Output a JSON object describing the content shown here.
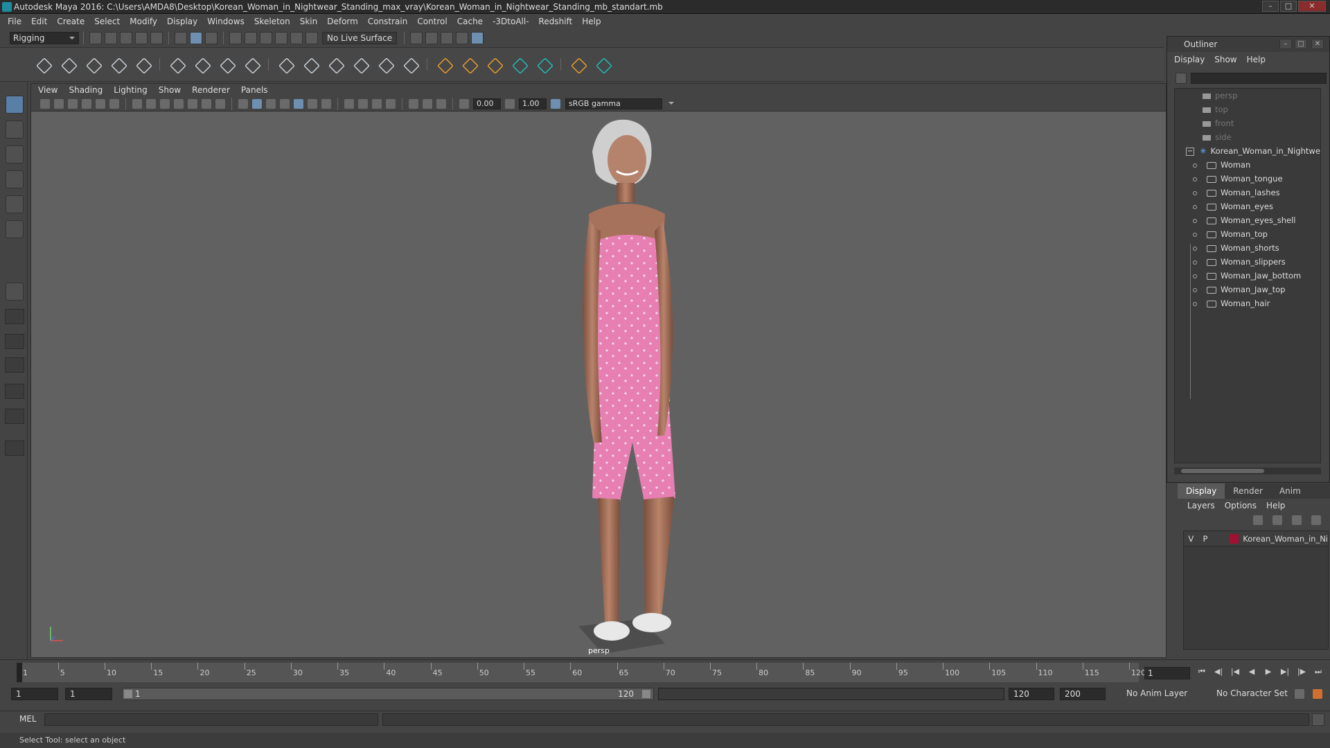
{
  "title_bar": {
    "title": "Autodesk Maya 2016: C:\\Users\\AMDA8\\Desktop\\Korean_Woman_in_Nightwear_Standing_max_vray\\Korean_Woman_in_Nightwear_Standing_mb_standart.mb"
  },
  "menubar": {
    "items": [
      "File",
      "Edit",
      "Create",
      "Select",
      "Modify",
      "Display",
      "Windows",
      "Skeleton",
      "Skin",
      "Deform",
      "Constrain",
      "Control",
      "Cache",
      "-3DtoAll-",
      "Redshift",
      "Help"
    ]
  },
  "status_line": {
    "mode": "Rigging",
    "live_surface": "No Live Surface"
  },
  "viewport": {
    "menu": [
      "View",
      "Shading",
      "Lighting",
      "Show",
      "Renderer",
      "Panels"
    ],
    "exposure": "0.00",
    "gamma": "1.00",
    "color_space": "sRGB gamma",
    "camera_label": "persp"
  },
  "outliner": {
    "title": "Outliner",
    "menu": [
      "Display",
      "Show",
      "Help"
    ],
    "items": [
      {
        "label": "persp",
        "kind": "camera",
        "dim": true
      },
      {
        "label": "top",
        "kind": "camera",
        "dim": true
      },
      {
        "label": "front",
        "kind": "camera",
        "dim": true
      },
      {
        "label": "side",
        "kind": "camera",
        "dim": true
      },
      {
        "label": "Korean_Woman_in_Nightwe",
        "kind": "group",
        "dim": false
      },
      {
        "label": "Woman",
        "kind": "mesh",
        "dim": false
      },
      {
        "label": "Woman_tongue",
        "kind": "mesh",
        "dim": false
      },
      {
        "label": "Woman_lashes",
        "kind": "mesh",
        "dim": false
      },
      {
        "label": "Woman_eyes",
        "kind": "mesh",
        "dim": false
      },
      {
        "label": "Woman_eyes_shell",
        "kind": "mesh",
        "dim": false
      },
      {
        "label": "Woman_top",
        "kind": "mesh",
        "dim": false
      },
      {
        "label": "Woman_shorts",
        "kind": "mesh",
        "dim": false
      },
      {
        "label": "Woman_slippers",
        "kind": "mesh",
        "dim": false
      },
      {
        "label": "Woman_Jaw_bottom",
        "kind": "mesh",
        "dim": false
      },
      {
        "label": "Woman_Jaw_top",
        "kind": "mesh",
        "dim": false
      },
      {
        "label": "Woman_hair",
        "kind": "mesh",
        "dim": false
      }
    ]
  },
  "layers": {
    "tabs": [
      "Display",
      "Render",
      "Anim"
    ],
    "menu": [
      "Layers",
      "Options",
      "Help"
    ],
    "row": {
      "v": "V",
      "p": "P",
      "name": "Korean_Woman_in_Ni",
      "color": "#a01030"
    }
  },
  "timeline": {
    "ticks": [
      "1",
      "5",
      "10",
      "15",
      "20",
      "25",
      "30",
      "35",
      "40",
      "45",
      "50",
      "55",
      "60",
      "65",
      "70",
      "75",
      "80",
      "85",
      "90",
      "95",
      "100",
      "105",
      "110",
      "115",
      "120"
    ],
    "current_frame": "1"
  },
  "range": {
    "start": "1",
    "playback_start": "1",
    "slider_start": "1",
    "slider_end": "120",
    "playback_end": "120",
    "end": "200",
    "anim_layer": "No Anim Layer",
    "character_set": "No Character Set"
  },
  "command_line": {
    "label": "MEL"
  },
  "help_line": {
    "text": "Select Tool: select an object"
  }
}
